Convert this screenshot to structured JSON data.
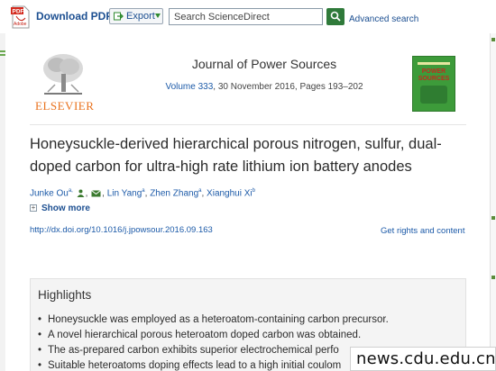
{
  "toolbar": {
    "download_pdf": "Download PDF",
    "pdf_badge": "PDF",
    "pdf_badge_sub": "Adobe",
    "export_label": "Export",
    "search_placeholder": "Search ScienceDirect",
    "advanced_search": "Advanced search"
  },
  "journal": {
    "publisher": "ELSEVIER",
    "title": "Journal of Power Sources",
    "volume_link": "Volume 333",
    "details": ", 30 November 2016, Pages 193–202",
    "cover_title": "POWER SOURCES"
  },
  "article": {
    "title": "Honeysuckle-derived hierarchical porous nitrogen, sulfur, dual-doped carbon for ultra-high rate lithium ion battery anodes",
    "authors": [
      {
        "name": "Junke Ou",
        "sup": "a,"
      },
      {
        "name": "Lin Yang",
        "sup": "a"
      },
      {
        "name": "Zhen Zhang",
        "sup": "a"
      },
      {
        "name": "Xianghui Xi",
        "sup": "b"
      }
    ],
    "show_more": "Show more",
    "doi": "http://dx.doi.org/10.1016/j.jpowsour.2016.09.163",
    "rights": "Get rights and content"
  },
  "highlights": {
    "title": "Highlights",
    "items": [
      "Honeysuckle was employed as a heteroatom-containing carbon precursor.",
      "A novel hierarchical porous heteroatom doped carbon was obtained.",
      "The as-prepared carbon exhibits superior electrochemical perfo",
      "Suitable heteroatoms doping effects lead to a high initial coulom"
    ]
  },
  "watermark": "news.cdu.edu.cn",
  "colors": {
    "link": "#1c5aa8",
    "brand_green": "#2f7a3a",
    "elsevier_orange": "#e9711c",
    "cover_green": "#3d9b3a"
  }
}
